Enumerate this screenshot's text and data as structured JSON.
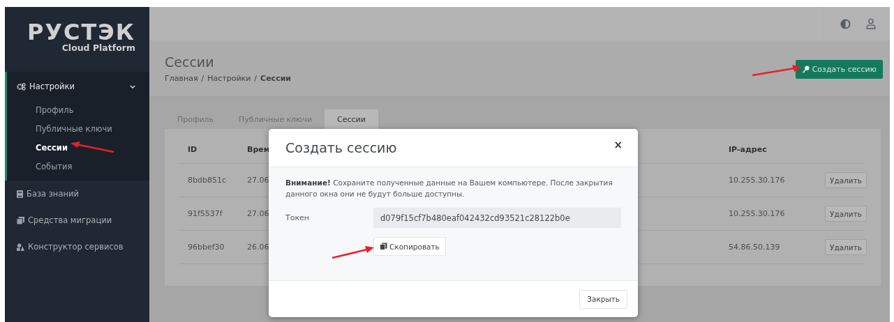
{
  "logo": {
    "wordmark": "РУСТЭК",
    "subtitle": "Cloud Platform"
  },
  "sidebar": {
    "items": [
      {
        "label": "Настройки",
        "expanded": true,
        "children": [
          {
            "label": "Профиль",
            "selected": false
          },
          {
            "label": "Публичные ключи",
            "selected": false
          },
          {
            "label": "Сессии",
            "selected": true
          },
          {
            "label": "События",
            "selected": false
          }
        ]
      },
      {
        "label": "База знаний"
      },
      {
        "label": "Средства миграции"
      },
      {
        "label": "Конструктор сервисов"
      }
    ]
  },
  "page": {
    "title": "Сессии",
    "breadcrumb": [
      {
        "label": "Главная",
        "current": false
      },
      {
        "label": "Настройки",
        "current": false
      },
      {
        "label": "Сессии",
        "current": true
      }
    ],
    "separator": "/",
    "create_button": "Создать сессию"
  },
  "tabs": [
    {
      "label": "Профиль",
      "selected": false
    },
    {
      "label": "Публичные ключи",
      "selected": false
    },
    {
      "label": "Сессии",
      "selected": true
    }
  ],
  "table": {
    "columns": [
      "ID",
      "Врем",
      "IP-адрес"
    ],
    "rows": [
      {
        "id": "8bdb851c",
        "time": "27.06",
        "ip": "10.255.30.176",
        "action": "Удалить"
      },
      {
        "id": "91f5537f",
        "time": "27.06",
        "ip": "10.255.30.176",
        "action": "Удалить"
      },
      {
        "id": "96bbef30",
        "time": "26.06",
        "ip": "54.86.50.139",
        "action": "Удалить"
      }
    ]
  },
  "modal": {
    "title": "Создать сессию",
    "close": "×",
    "warning": "**Внимание!** Сохраните полученные данные на Вашем компьютере. После закрытия данного окна они не будут больше доступны.",
    "token_label": "Токен",
    "token_value": "d079f15cf7b480eaf042432cd93521c28122b0e",
    "copy_button": "Скопировать",
    "close_button": "Закрыть"
  }
}
